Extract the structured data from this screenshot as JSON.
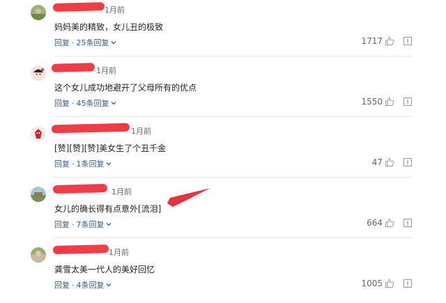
{
  "comments": [
    {
      "time": "1月前",
      "text": "妈妈美的精致，女儿丑的极致",
      "reply_label": "回复",
      "replies_label": "25条回复",
      "likes": "1717"
    },
    {
      "time": "1月前",
      "text": "这个女儿成功地避开了父母所有的优点",
      "reply_label": "回复",
      "replies_label": "45条回复",
      "likes": "1550"
    },
    {
      "time": "1月前",
      "text": "[赞][赞][赞]美女生了个丑千金",
      "reply_label": "回复",
      "replies_label": "1条回复",
      "likes": "47"
    },
    {
      "time": "1月前",
      "text": "女儿的确长得有点意外[流泪]",
      "reply_label": "回复",
      "replies_label": "7条回复",
      "likes": "664"
    },
    {
      "time": "1月前",
      "text": "龚雪太美一代人的美好回忆",
      "reply_label": "回复",
      "replies_label": "4条回复",
      "likes": "1005"
    }
  ],
  "separator": "·",
  "colors": {
    "redaction": "#f03c46",
    "action_link": "#3b5a86",
    "arrow": "#e8303c"
  },
  "icons": [
    "chevron-down-icon",
    "thumb-up-icon",
    "report-icon"
  ]
}
